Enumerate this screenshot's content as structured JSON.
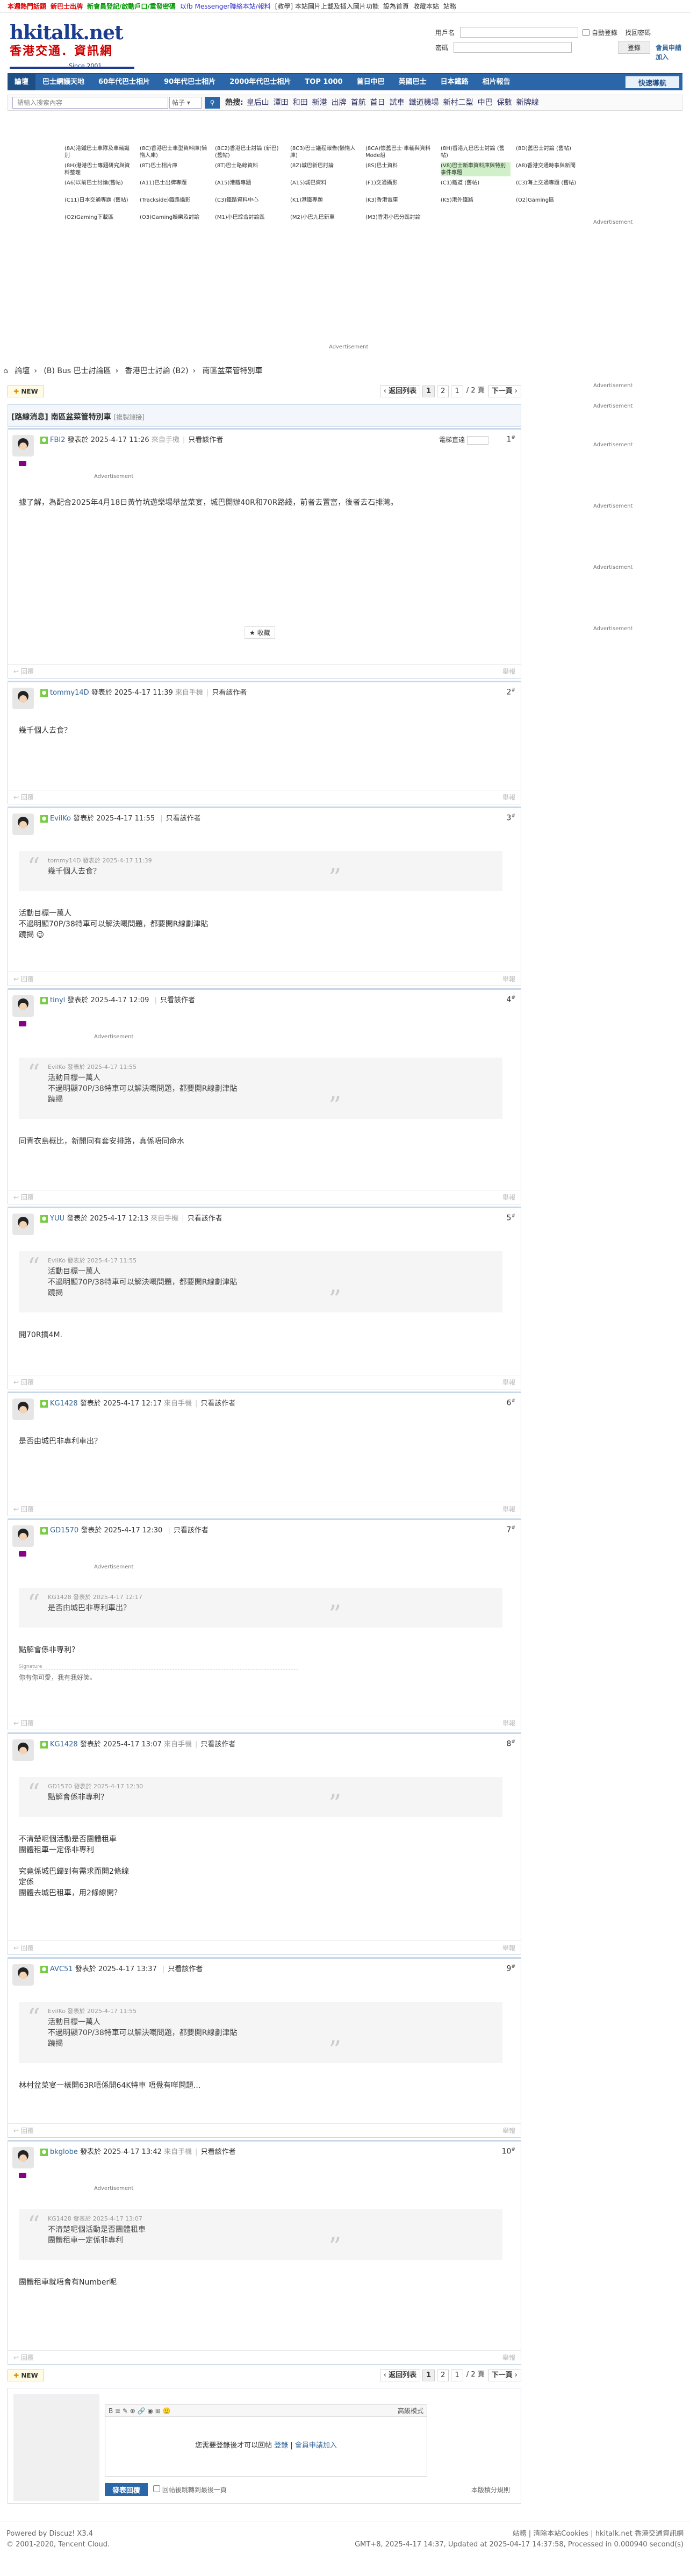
{
  "topbar": {
    "left": [
      {
        "text": "本週熱門話題",
        "color": "#d00"
      },
      {
        "text": "新巴士出牌",
        "color": "#d00"
      },
      {
        "text": "新會員登記/啟動戶口/重發密碼",
        "color": "#090"
      },
      {
        "text": "以fb Messenger聯絡本站/報料",
        "color": "#33c"
      },
      {
        "text": "[教學] 本站圖片上載及插入圖片功能",
        "color": "#333"
      },
      {
        "text": "設為首頁",
        "color": "#333"
      },
      {
        "text": "收藏本站",
        "color": "#333"
      },
      {
        "text": "站務",
        "color": "#333"
      }
    ]
  },
  "logo": {
    "title": "hkitalk.net",
    "subtitle": "香港交通．資訊網",
    "since": "Since 2001"
  },
  "login": {
    "user_label": "用戶名",
    "auto_login": "自動登錄",
    "forgot": "找回密碼",
    "pass_label": "密碼",
    "login_button": "登錄",
    "register": "會員申請加入"
  },
  "nav": {
    "items": [
      "論壇",
      "巴士網議天地",
      "60年代巴士相片",
      "90年代巴士相片",
      "2000年代巴士相片",
      "TOP 1000",
      "首日中巴",
      "英國巴士",
      "日本鐵路",
      "相片報告"
    ],
    "quick": "快速導航"
  },
  "search": {
    "placeholder": "請輸入搜索內容",
    "scope": "帖子",
    "hot_label": "熱搜:",
    "hot": [
      "皇后山",
      "潭田",
      "和田",
      "新港",
      "出牌",
      "首航",
      "首日",
      "試車",
      "鐵道機場",
      "新村二型",
      "中巴",
      "保數",
      "新牌線"
    ]
  },
  "adgrid": [
    {
      "text": "(8A)港鐵巴士車隊及車輛識別",
      "hl": false
    },
    {
      "text": "(8C)香港巴士車型資料庫(懶惰人庫)",
      "hl": false
    },
    {
      "text": "(8C2)香港巴士討論 (新巴) (舊帖)",
      "hl": false
    },
    {
      "text": "(8C3)巴士議程報告(懶惰人庫)",
      "hl": false
    },
    {
      "text": "(8CA)懷舊巴士·車輛與資料Mode組",
      "hl": false
    },
    {
      "text": "(8H)香港九巴巴士討論 (舊帖)",
      "hl": false
    },
    {
      "text": "(8D)舊巴士討論 (舊帖)",
      "hl": false
    },
    {
      "text": "(8H)港港巴士專題研究與資料整理",
      "hl": false
    },
    {
      "text": "(8T)巴士相片庫",
      "hl": false
    },
    {
      "text": "(8T)巴士路線資料",
      "hl": false
    },
    {
      "text": "(8Z)城巴新巴討論",
      "hl": false
    },
    {
      "text": "(8S)巴士資料",
      "hl": false
    },
    {
      "text": "(V8)巴士新車資料庫與特別事件專題",
      "hl": true
    },
    {
      "text": "(A8)香港交通時事與新聞",
      "hl": false
    },
    {
      "text": "(A6)以前巴士討論(舊帖)",
      "hl": false
    },
    {
      "text": "(A11)巴士出牌專題",
      "hl": false
    },
    {
      "text": "(A15)港鐵專題",
      "hl": false
    },
    {
      "text": "(A15)城巴資料",
      "hl": false
    },
    {
      "text": "(F1)交通攝影",
      "hl": false
    },
    {
      "text": "(C1)鐵道 (舊帖)",
      "hl": false
    },
    {
      "text": "(C3)海上交通專題 (舊帖)",
      "hl": false
    },
    {
      "text": "(C11)日本交通專題 (舊帖)",
      "hl": false
    },
    {
      "text": "(Trackside)鐵路攝影",
      "hl": false
    },
    {
      "text": "(C3)鐵路資料中心",
      "hl": false
    },
    {
      "text": "(K1)港鐵專題",
      "hl": false
    },
    {
      "text": "(K3)香港電車",
      "hl": false
    },
    {
      "text": "(K5)港外鐵路",
      "hl": false
    },
    {
      "text": "(O2)Gaming區",
      "hl": false
    },
    {
      "text": "(O2)Gaming下載區",
      "hl": false
    },
    {
      "text": "(O3)Gaming娛樂及討論",
      "hl": false
    },
    {
      "text": "(M1)小巴綜合討論區",
      "hl": false
    },
    {
      "text": "(M2)小巴九巴新車",
      "hl": false
    },
    {
      "text": "(M3)香港小巴分區討論",
      "hl": false
    }
  ],
  "ad_label": "Advertisement",
  "breadcrumb": [
    "論壇",
    "(B) Bus 巴士討論區",
    "香港巴士討論 (B2)",
    "南區盆菜管特別車"
  ],
  "pager": {
    "new": "NEW",
    "back": "返回列表",
    "pages": [
      "1",
      "2"
    ],
    "input": "1",
    "total": "/ 2 頁",
    "next": "下一頁"
  },
  "thread": {
    "title": "[路線消息] 南區盆菜管特別車",
    "tag": "[複製鏈接]"
  },
  "posts": [
    {
      "user": "FBI2",
      "time": "發表於 2025-4-17 11:26",
      "device": "來自手機",
      "only": "只看該作者",
      "floor": "1",
      "extra": "電梯直達",
      "body": "據了解，為配合2025年4月18日黃竹坑遊樂場舉盆菜宴，城巴開辦40R和70R路綫，前者去置富，後者去石排灣。",
      "collect": "收藏"
    },
    {
      "user": "tommy14D",
      "time": "發表於 2025-4-17 11:39",
      "device": "來自手機",
      "only": "只看該作者",
      "floor": "2",
      "body": "幾千個人去食？"
    },
    {
      "user": "EvilKo",
      "time": "發表於 2025-4-17 11:55",
      "device": "",
      "only": "只看該作者",
      "floor": "3",
      "quote_head": "tommy14D 發表於 2025-4-17 11:39",
      "quote": "幾千個人去食？",
      "body": "活動目標一萬人\n不過明顯70P/38特車可以解決嘅問題，都要開R線劃津貼\n蹺揭 😉"
    },
    {
      "user": "tinyl",
      "time": "發表於 2025-4-17 12:09",
      "device": "",
      "only": "只看該作者",
      "floor": "4",
      "quote_head": "EvilKo 發表於 2025-4-17 11:55",
      "quote": "活動目標一萬人\n不過明顯70P/38特車可以解決嘅問題，都要開R線劃津貼\n蹺揭",
      "body": "同青衣島概比，新開同有套安排路，真係唔同命水"
    },
    {
      "user": "YUU",
      "time": "發表於 2025-4-17 12:13",
      "device": "來自手機",
      "only": "只看該作者",
      "floor": "5",
      "quote_head": "EvilKo 發表於 2025-4-17 11:55",
      "quote": "活動目標一萬人\n不過明顯70P/38特車可以解決嘅問題，都要開R線劃津貼\n蹺揭",
      "body": "開70R搞4M."
    },
    {
      "user": "KG1428",
      "time": "發表於 2025-4-17 12:17",
      "device": "來自手機",
      "only": "只看該作者",
      "floor": "6",
      "body": "是否由城巴非專利車出？"
    },
    {
      "user": "GD1570",
      "time": "發表於 2025-4-17 12:30",
      "device": "",
      "only": "只看該作者",
      "floor": "7",
      "quote_head": "KG1428 發表於 2025-4-17 12:17",
      "quote": "是否由城巴非專利車出？",
      "body": "點解會係非專利？",
      "sig1": "Signature",
      "sig2": "你有你可愛，我有我好笑。"
    },
    {
      "user": "KG1428",
      "time": "發表於 2025-4-17 13:07",
      "device": "來自手機",
      "only": "只看該作者",
      "floor": "8",
      "quote_head": "GD1570 發表於 2025-4-17 12:30",
      "quote": "點解會係非專利？",
      "body": "不清楚呢個活動是否團體租車\n團體租車一定係非專利\n\n究竟係城巴歸到有需求而開2條線\n定係\n團體去城巴租車，用2條線開？"
    },
    {
      "user": "AVC51",
      "time": "發表於 2025-4-17 13:37",
      "device": "",
      "only": "只看該作者",
      "floor": "9",
      "quote_head": "EvilKo 發表於 2025-4-17 11:55",
      "quote": "活動目標一萬人\n不過明顯70P/38特車可以解決嘅問題，都要開R線劃津貼\n蹺揭",
      "body": "林村盆菜宴一樣開63R唔係開64K特車 唔覺有咩問題..."
    },
    {
      "user": "bkglobe",
      "time": "發表於 2025-4-17 13:42",
      "device": "來自手機",
      "only": "只看該作者",
      "floor": "10",
      "quote_head": "KG1428 發表於 2025-4-17 13:07",
      "quote": "不清楚呢個活動是否團體租車\n團體租車一定係非專利",
      "body": "團體租車就唔會有Number呢"
    }
  ],
  "post_footer": {
    "left": "回覆",
    "right": "舉報"
  },
  "reply": {
    "toolbar": "B ≡ ✎ ⊕ 🔗 ◉ ⊞ 🙂",
    "mode": "高級模式",
    "need": "您需要登錄後才可以回帖",
    "login": "登錄",
    "sep": "|",
    "register": "會員申請加入",
    "submit": "發表回覆",
    "jump": "回帖後跳轉到最後一頁",
    "rules": "本版積分規則"
  },
  "footer": {
    "left1": "Powered by Discuz! X3.4",
    "left2": "© 2001-2020, Tencent Cloud.",
    "right1": "站務 | 清除本站Cookies | hkitalk.net 香港交通資訊網",
    "right2": "GMT+8, 2025-4-17 14:37, Updated at 2025-04-17 14:37:58, Processed in 0.000940 second(s)"
  }
}
